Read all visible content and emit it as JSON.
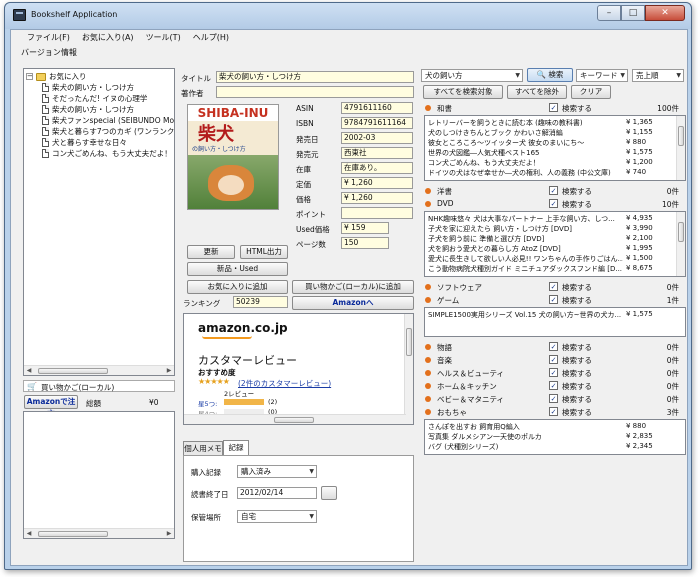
{
  "window": {
    "title": "Bookshelf Application"
  },
  "menu": {
    "items": [
      "ファイル(F)",
      "お気に入り(A)",
      "ツール(T)",
      "ヘルプ(H)"
    ],
    "version_item": "バージョン情報"
  },
  "tree": {
    "root": "お気に入り",
    "items": [
      "柴犬の飼い方・しつけ方",
      "そだったんだ! イヌの心理学",
      "柴犬の飼い方・しつけ方",
      "柴犬ファンspecial (SEIBUNDO Mo",
      "柴犬と暮らす7つのカギ (ワンランク",
      "犬と暮らす幸せな日々",
      "コン犬ごめんね、もう大丈夫だよ！"
    ]
  },
  "cart": {
    "title": "買い物かご(ローカル)",
    "order_button": "Amazonで注文",
    "total_label": "総額",
    "total_value": "¥0"
  },
  "detail": {
    "title_label": "タイトル",
    "title_value": "柴犬の飼い方・しつけ方",
    "author_label": "著作者",
    "author_value": "",
    "cover_text_top": "SHIBA-INU",
    "cover_text_main": "柴犬",
    "cover_text_sub": "の飼い方・しつけ方",
    "fields": [
      {
        "label": "ASIN",
        "value": "4791611160"
      },
      {
        "label": "ISBN",
        "value": "9784791611164"
      },
      {
        "label": "発売日",
        "value": "2002-03"
      },
      {
        "label": "発売元",
        "value": "西東社"
      },
      {
        "label": "在庫",
        "value": "在庫あり。"
      },
      {
        "label": "定価",
        "value": "¥ 1,260"
      },
      {
        "label": "価格",
        "value": "¥ 1,260"
      },
      {
        "label": "ポイント",
        "value": ""
      },
      {
        "label": "Used価格",
        "value": "¥ 159"
      },
      {
        "label": "ページ数",
        "value": "150"
      }
    ],
    "update_button": "更新",
    "html_button": "HTML出力",
    "new_used_button": "新品・Used",
    "add_fav_button": "お気に入りに追加",
    "add_cart_button": "買い物かご(ローカル)に追加",
    "ranking_label": "ランキング",
    "ranking_value": "50239",
    "amazon_button": "Amazonへ"
  },
  "review": {
    "logo": "amazon.co.jp",
    "heading": "カスタマーレビュー",
    "sub": "おすすめ度",
    "stars": "★★★★★",
    "link": "(2件のカスタマーレビュー)",
    "count_label": "2レビュー",
    "rows": [
      {
        "label": "星5つ:",
        "count": "(2)",
        "fill": 1.0
      },
      {
        "label": "星4つ:",
        "count": "(0)",
        "fill": 0.0
      }
    ]
  },
  "tabs": {
    "memo": "個人用メモ",
    "record": "記録"
  },
  "record": {
    "purchase_label": "購入記録",
    "purchase_value": "購入済み",
    "read_date_label": "読書終了日",
    "read_date_value": "2012/02/14",
    "location_label": "保管場所",
    "location_value": "自宅"
  },
  "search": {
    "query": "犬の飼い方",
    "search_button": "検索",
    "mode": "キーワード",
    "sort": "売上順",
    "all_target_button": "すべてを検索対象",
    "all_exclude_button": "すべてを除外",
    "clear_button": "クリア",
    "check_label": "検索する"
  },
  "categories": [
    {
      "name": "和書",
      "count": "100件",
      "items": [
        {
          "t": "レトリーバーを飼うときに読む本 (趣味の教科書)",
          "p": "¥ 1,365"
        },
        {
          "t": "犬のしつけきちんとブック かわいさ解消編",
          "p": "¥ 1,155"
        },
        {
          "t": "彼女ところころ〜ツイッター犬  彼女のまいにち〜",
          "p": "¥ 880"
        },
        {
          "t": "世界の犬図鑑―人気犬種ベスト165",
          "p": "¥ 1,575"
        },
        {
          "t": "コン犬ごめんね、もう大丈夫だよ！",
          "p": "¥ 1,200"
        },
        {
          "t": "ドイツの犬はなぜ幸せか―犬の権利、人の義務 (中公文庫)",
          "p": "¥ 740"
        }
      ]
    },
    {
      "name": "洋書",
      "count": "0件",
      "items": []
    },
    {
      "name": "DVD",
      "count": "10件",
      "items": [
        {
          "t": "NHK趣味悠々 犬は大事なパートナー 上手な飼い方、しつ...",
          "p": "¥ 4,935"
        },
        {
          "t": "子犬を家に迎えたら 飼い方・しつけ方 [DVD]",
          "p": "¥ 3,990"
        },
        {
          "t": "子犬を飼う前に 準備と選び方 [DVD]",
          "p": "¥ 2,100"
        },
        {
          "t": "犬を飼おう愛犬との暮らし方 AtoZ [DVD]",
          "p": "¥ 1,995"
        },
        {
          "t": "愛犬に長生きして欲しい人必見!! ワンちゃんの手作りごはん...",
          "p": "¥ 1,500"
        },
        {
          "t": "こう動物病院犬種別ガイド ミニチュアダックスフンド編 [D...",
          "p": "¥ 8,675"
        }
      ]
    },
    {
      "name": "ソフトウェア",
      "count": "0件",
      "items": []
    },
    {
      "name": "ゲーム",
      "count": "1件",
      "items": [
        {
          "t": "SIMPLE1500実用シリーズ Vol.15 犬の飼い方~世界の犬カ...",
          "p": "¥ 1,575"
        }
      ]
    },
    {
      "name": "物語",
      "count": "0件",
      "items": []
    },
    {
      "name": "音楽",
      "count": "0件",
      "items": []
    },
    {
      "name": "ヘルス＆ビューティ",
      "count": "0件",
      "items": []
    },
    {
      "name": "ホーム＆キッチン",
      "count": "0件",
      "items": []
    },
    {
      "name": "ベビー＆マタニティ",
      "count": "0件",
      "items": []
    },
    {
      "name": "おもちゃ",
      "count": "3件",
      "items": [
        {
          "t": "さんぽを出すお 飼育用Q編入",
          "p": "¥ 880"
        },
        {
          "t": "写真集 ダルメシアン一天使のポルカ",
          "p": "¥ 2,835"
        },
        {
          "t": "バグ (犬種別シリーズ)",
          "p": "¥ 2,345"
        }
      ]
    }
  ],
  "colors": {
    "accent": "#e3701c",
    "field_bg": "#fffde0",
    "titlebar": "#b9d1ea"
  },
  "icons": [
    "folder-icon",
    "document-icon",
    "search-icon",
    "cart-icon",
    "minimize-icon",
    "maximize-icon",
    "close-icon"
  ]
}
